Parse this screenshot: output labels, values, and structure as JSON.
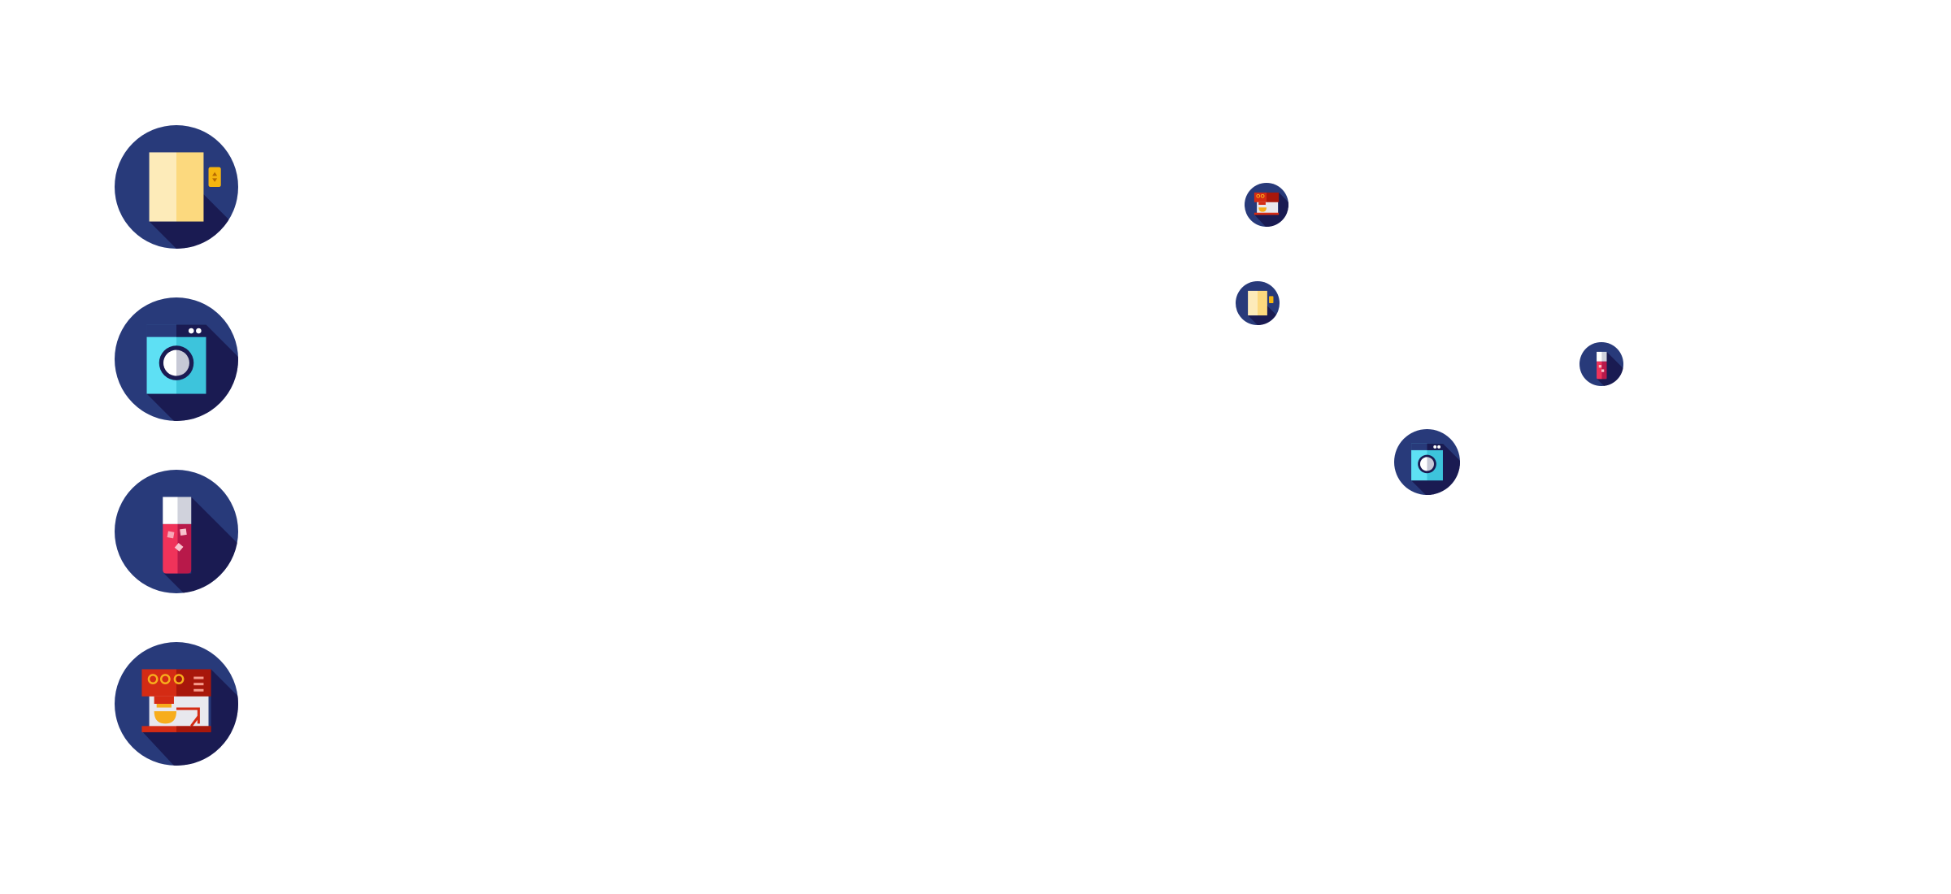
{
  "icons": {
    "left_column": [
      {
        "name": "refrigerator-icon"
      },
      {
        "name": "washing-machine-icon"
      },
      {
        "name": "drink-glass-icon"
      },
      {
        "name": "coffee-machine-icon"
      }
    ],
    "scattered": [
      {
        "name": "coffee-machine-icon"
      },
      {
        "name": "refrigerator-icon"
      },
      {
        "name": "drink-glass-icon"
      },
      {
        "name": "washing-machine-icon"
      }
    ]
  },
  "colors": {
    "circle": "#283a7a",
    "shadow": "#1a1b52",
    "fridge_light": "#fdebb9",
    "fridge_dark": "#fcd97e",
    "handle": "#f5b50f",
    "washer_light": "#5ee0f4",
    "washer_dark": "#3dc4dc",
    "drink_red": "#f0335a",
    "drink_dark": "#b8194a",
    "coffee_red": "#d42b14",
    "coffee_orange": "#f7ad1c"
  }
}
